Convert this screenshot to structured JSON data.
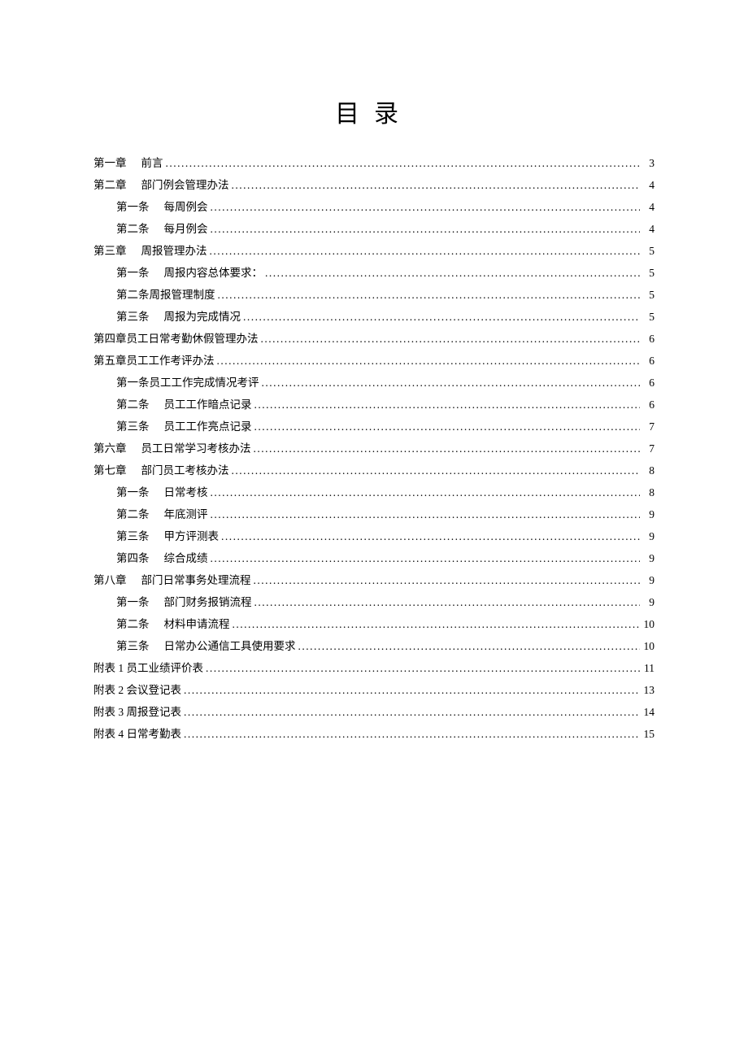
{
  "title": "目录",
  "toc": [
    {
      "level": 0,
      "label": "第一章",
      "gap": "   ",
      "text": "前言",
      "page": "3"
    },
    {
      "level": 0,
      "label": "第二章",
      "gap": "   ",
      "text": "部门例会管理办法",
      "page": "4"
    },
    {
      "level": 1,
      "label": "第一条",
      "gap": "   ",
      "text": "每周例会",
      "page": "4"
    },
    {
      "level": 1,
      "label": "第二条",
      "gap": "   ",
      "text": "每月例会",
      "page": "4"
    },
    {
      "level": 0,
      "label": "第三章",
      "gap": "   ",
      "text": "周报管理办法",
      "page": "5"
    },
    {
      "level": 1,
      "label": "第一条",
      "gap": "   ",
      "text": "周报内容总体要求：",
      "page": "5"
    },
    {
      "level": 1,
      "label": "",
      "gap": "",
      "text": "第二条周报管理制度",
      "page": "5"
    },
    {
      "level": 1,
      "label": "第三条",
      "gap": "   ",
      "text": "周报为完成情况",
      "page": "5"
    },
    {
      "level": 0,
      "label": "",
      "gap": "",
      "text": "第四章员工日常考勤休假管理办法",
      "page": "6"
    },
    {
      "level": 0,
      "label": "",
      "gap": "",
      "text": "第五章员工工作考评办法",
      "page": "6"
    },
    {
      "level": 1,
      "label": "",
      "gap": "",
      "text": "第一条员工工作完成情况考评",
      "page": "6"
    },
    {
      "level": 1,
      "label": "第二条",
      "gap": "   ",
      "text": "员工工作暗点记录",
      "page": "6"
    },
    {
      "level": 1,
      "label": "第三条",
      "gap": "   ",
      "text": "员工工作亮点记录",
      "page": "7"
    },
    {
      "level": 0,
      "label": "第六章",
      "gap": "   ",
      "text": "员工日常学习考核办法",
      "page": "7"
    },
    {
      "level": 0,
      "label": "第七章",
      "gap": "   ",
      "text": "部门员工考核办法",
      "page": "8"
    },
    {
      "level": 1,
      "label": "第一条",
      "gap": "   ",
      "text": "日常考核",
      "page": "8"
    },
    {
      "level": 1,
      "label": "第二条",
      "gap": "   ",
      "text": "年底测评",
      "page": "9"
    },
    {
      "level": 1,
      "label": "第三条",
      "gap": "   ",
      "text": "甲方评测表",
      "page": "9"
    },
    {
      "level": 1,
      "label": "第四条",
      "gap": "   ",
      "text": "综合成绩",
      "page": "9"
    },
    {
      "level": 0,
      "label": "第八章",
      "gap": "   ",
      "text": "部门日常事务处理流程",
      "page": "9"
    },
    {
      "level": 1,
      "label": "第一条",
      "gap": "   ",
      "text": "部门财务报销流程",
      "page": "9"
    },
    {
      "level": 1,
      "label": "第二条",
      "gap": "   ",
      "text": "材料申请流程",
      "page": "10"
    },
    {
      "level": 1,
      "label": "第三条",
      "gap": "   ",
      "text": "日常办公通信工具使用要求",
      "page": "10"
    },
    {
      "level": 0,
      "label": "",
      "gap": "",
      "text": "附表 1 员工业绩评价表",
      "page": "11"
    },
    {
      "level": 0,
      "label": "",
      "gap": "",
      "text": "附表 2 会议登记表",
      "page": "13"
    },
    {
      "level": 0,
      "label": "",
      "gap": "",
      "text": "附表 3 周报登记表",
      "page": "14"
    },
    {
      "level": 0,
      "label": "",
      "gap": "",
      "text": "附表 4 日常考勤表",
      "page": "15"
    }
  ]
}
